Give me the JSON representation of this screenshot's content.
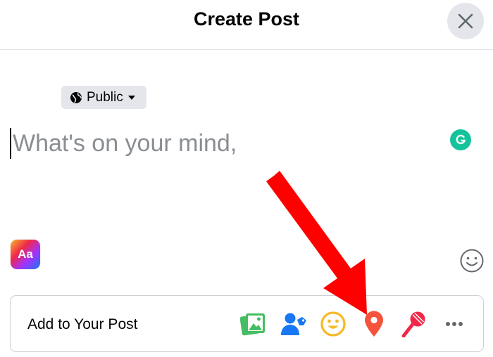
{
  "header": {
    "title": "Create Post"
  },
  "privacy": {
    "label": "Public"
  },
  "composer": {
    "placeholder": "What's on your mind,"
  },
  "text_style_button": {
    "label": "Aa"
  },
  "add_to_post": {
    "label": "Add to Your Post",
    "tools": [
      {
        "icon": "photo-video-icon",
        "color": "#45bd62"
      },
      {
        "icon": "tag-people-icon",
        "color": "#1877f2"
      },
      {
        "icon": "feeling-activity-icon",
        "color": "#f7b928"
      },
      {
        "icon": "check-in-location-icon",
        "color": "#f5533d"
      },
      {
        "icon": "live-microphone-icon",
        "color": "#f02849"
      },
      {
        "icon": "more-icon",
        "color": "#65676b"
      }
    ]
  },
  "annotation": {
    "arrow_color": "#ff0000"
  }
}
